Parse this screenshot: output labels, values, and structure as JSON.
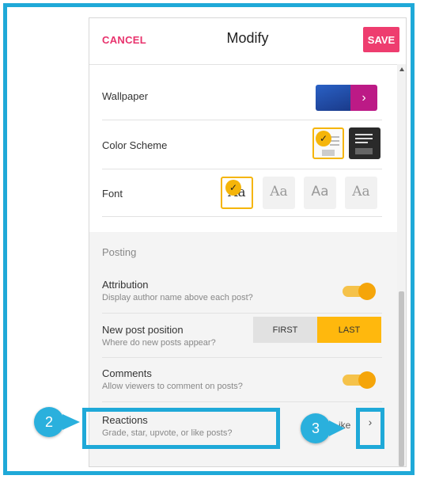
{
  "header": {
    "cancel_label": "CANCEL",
    "title": "Modify",
    "save_label": "SAVE"
  },
  "settings": {
    "wallpaper_label": "Wallpaper",
    "color_scheme_label": "Color Scheme",
    "font_label": "Font",
    "font_options": [
      "Aa",
      "Aa",
      "Aa",
      "Aa"
    ],
    "selected_font_index": 0,
    "selected_scheme_index": 0
  },
  "posting": {
    "section_label": "Posting",
    "attribution": {
      "label": "Attribution",
      "sub": "Display author name above each post?",
      "on": true
    },
    "new_post_position": {
      "label": "New post position",
      "sub": "Where do new posts appear?",
      "options": [
        "FIRST",
        "LAST"
      ],
      "selected": "LAST"
    },
    "comments": {
      "label": "Comments",
      "sub": "Allow viewers to comment on posts?",
      "on": true
    },
    "reactions": {
      "label": "Reactions",
      "sub": "Grade, star, upvote, or like posts?",
      "value_fragment": "ike"
    }
  },
  "callouts": {
    "badge_2": "2",
    "badge_3": "3"
  },
  "icons": {
    "wallpaper_arrow": "chevron-right-icon",
    "reactions_arrow": "chevron-right-icon",
    "check": "check-icon"
  },
  "colors": {
    "accent": "#ffb80d",
    "save": "#ee3d6f",
    "cancel": "#e8336d",
    "callout": "#1fa9d8",
    "wallpaper_arrow_bg": "#bc1a86"
  }
}
